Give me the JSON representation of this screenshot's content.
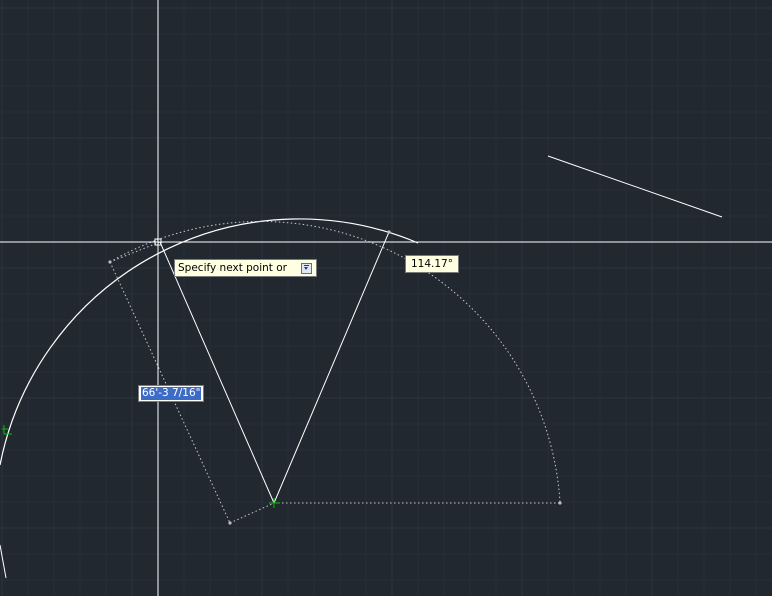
{
  "canvas": {
    "background": "#212830",
    "grid_minor_color": "#262e37",
    "grid_major_color": "#2d3540"
  },
  "dynamic_input": {
    "prompt_text": "Specify next point or",
    "options_icon": "dropdown-arrow-icon",
    "angle_value": "114.17°",
    "length_value": "66'-3 7/16\""
  },
  "colors": {
    "geometry": "#ffffff",
    "crosshair": "#ffffff",
    "tooltip_bg": "#ffffe1",
    "selection_highlight": "#3d6cc6",
    "snap_marker": "#00c000"
  }
}
